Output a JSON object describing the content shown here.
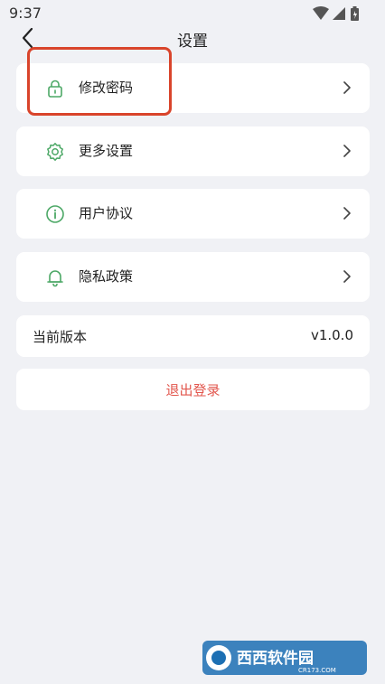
{
  "status_bar": {
    "time": "9:37"
  },
  "header": {
    "title": "设置"
  },
  "menu": {
    "items": [
      {
        "label": "修改密码",
        "icon": "lock-icon"
      },
      {
        "label": "更多设置",
        "icon": "gear-icon"
      },
      {
        "label": "用户协议",
        "icon": "info-icon"
      },
      {
        "label": "隐私政策",
        "icon": "bell-icon"
      }
    ]
  },
  "version": {
    "label": "当前版本",
    "value": "v1.0.0"
  },
  "logout": {
    "label": "退出登录"
  },
  "watermark": {
    "text": "西西软件园",
    "sub": "CR173.COM"
  },
  "colors": {
    "background": "#F0F1F5",
    "icon_green": "#4CA866",
    "logout_red": "#E2564D",
    "highlight": "#D9442B"
  }
}
